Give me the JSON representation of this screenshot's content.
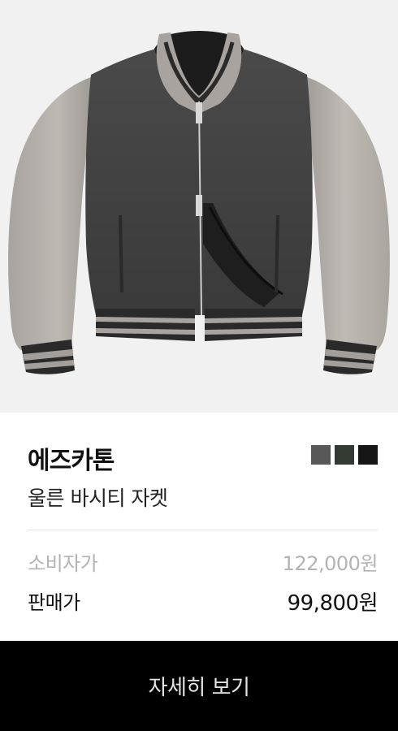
{
  "product": {
    "image_alt": "jacket-photo",
    "brand": "에즈카톤",
    "name": "울른 바시티 자켓",
    "color_swatches": [
      {
        "name": "charcoal-gray",
        "color": "#585858"
      },
      {
        "name": "dark-green-gray",
        "color": "#333a34"
      },
      {
        "name": "black",
        "color": "#161616"
      }
    ],
    "retail_price_label": "소비자가",
    "retail_price": "122,000원",
    "sale_price_label": "판매가",
    "sale_price": "99,800원"
  },
  "cta": {
    "detail_label": "자세히 보기",
    "background": "#000000"
  }
}
